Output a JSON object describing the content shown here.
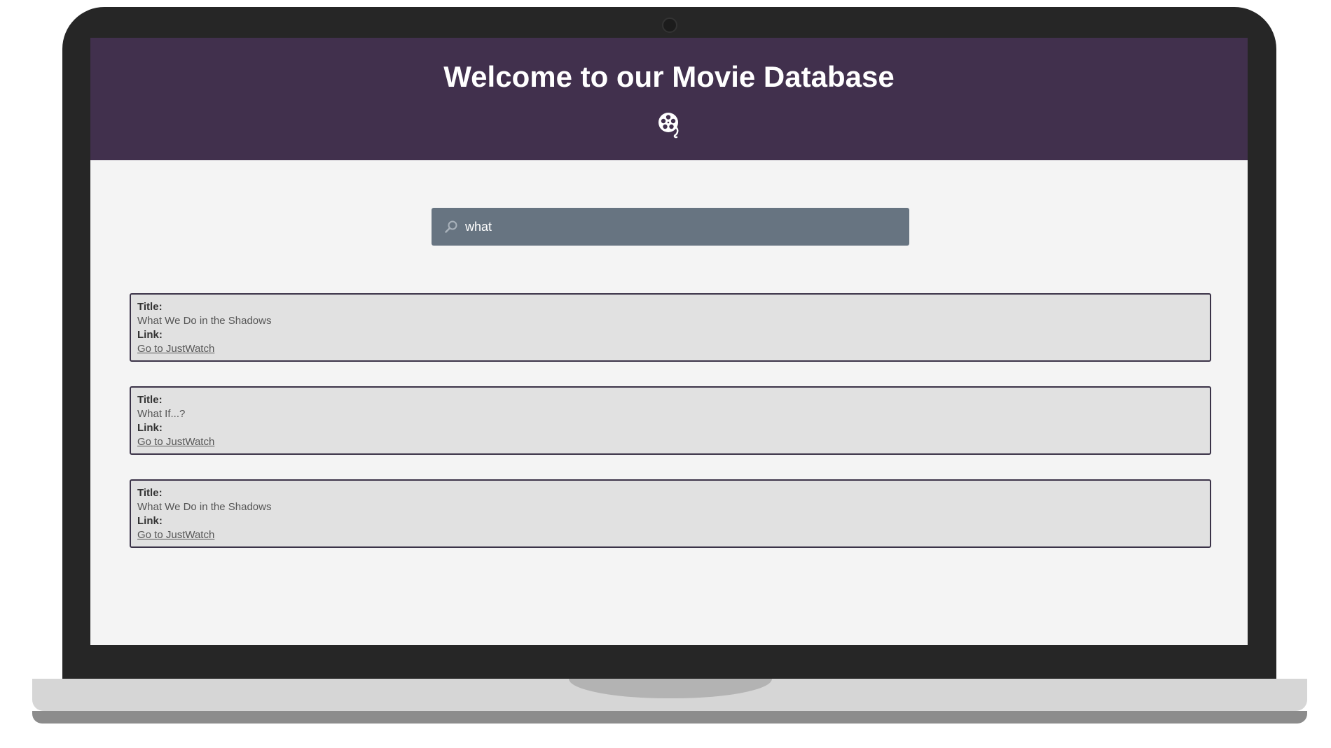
{
  "header": {
    "title": "Welcome to our Movie Database",
    "icon": "film-reel-icon",
    "background_color": "#41304d"
  },
  "search": {
    "value": "what",
    "placeholder": "",
    "icon": "search-icon",
    "background_color": "#677481"
  },
  "results": [
    {
      "title_label": "Title:",
      "title": "What We Do in the Shadows",
      "link_label": "Link:",
      "link_text": "Go to JustWatch"
    },
    {
      "title_label": "Title:",
      "title": "What If...?",
      "link_label": "Link:",
      "link_text": "Go to JustWatch"
    },
    {
      "title_label": "Title:",
      "title": "What We Do in the Shadows",
      "link_label": "Link:",
      "link_text": "Go to JustWatch"
    }
  ]
}
